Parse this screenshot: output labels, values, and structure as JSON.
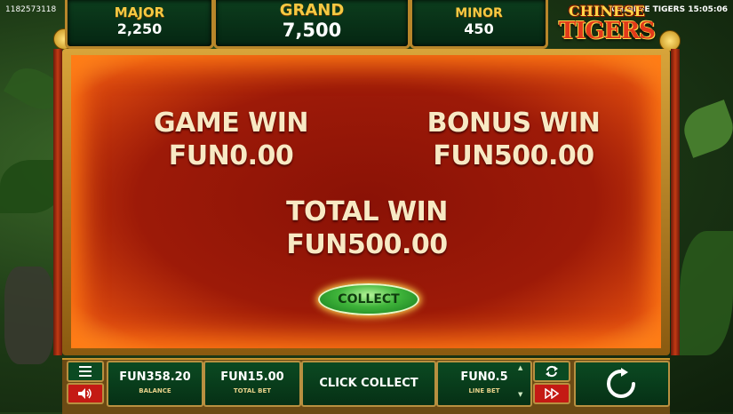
{
  "session_id": "1182573118",
  "clock": "CHINESE TIGERS 15:05:06",
  "jackpots": [
    {
      "label": "MAJOR",
      "value": "2,250"
    },
    {
      "label": "GRAND",
      "value": "7,500"
    },
    {
      "label": "MINOR",
      "value": "450"
    }
  ],
  "logo": {
    "line1": "CHINESE",
    "line2": "TIGERS"
  },
  "win_screen": {
    "game_win_label": "GAME WIN",
    "game_win_value": "FUN0.00",
    "bonus_win_label": "BONUS WIN",
    "bonus_win_value": "FUN500.00",
    "total_win_label": "TOTAL WIN",
    "total_win_value": "FUN500.00",
    "collect_label": "COLLECT"
  },
  "bottom_bar": {
    "balance_value": "FUN358.20",
    "balance_label": "BALANCE",
    "total_bet_value": "FUN15.00",
    "total_bet_label": "TOTAL BET",
    "status_text": "CLICK COLLECT",
    "line_bet_value": "FUN0.5",
    "line_bet_label": "LINE BET"
  },
  "icons": {
    "menu": "menu-icon",
    "sound": "speaker-icon",
    "autoplay": "autoplay-icon",
    "turbo": "fast-forward-icon",
    "spin": "spin-icon"
  },
  "colors": {
    "panel_green": "#0b4a22",
    "frame_gold": "#b89040",
    "win_red": "#9d1a08",
    "collect_green": "#3fb43a"
  }
}
